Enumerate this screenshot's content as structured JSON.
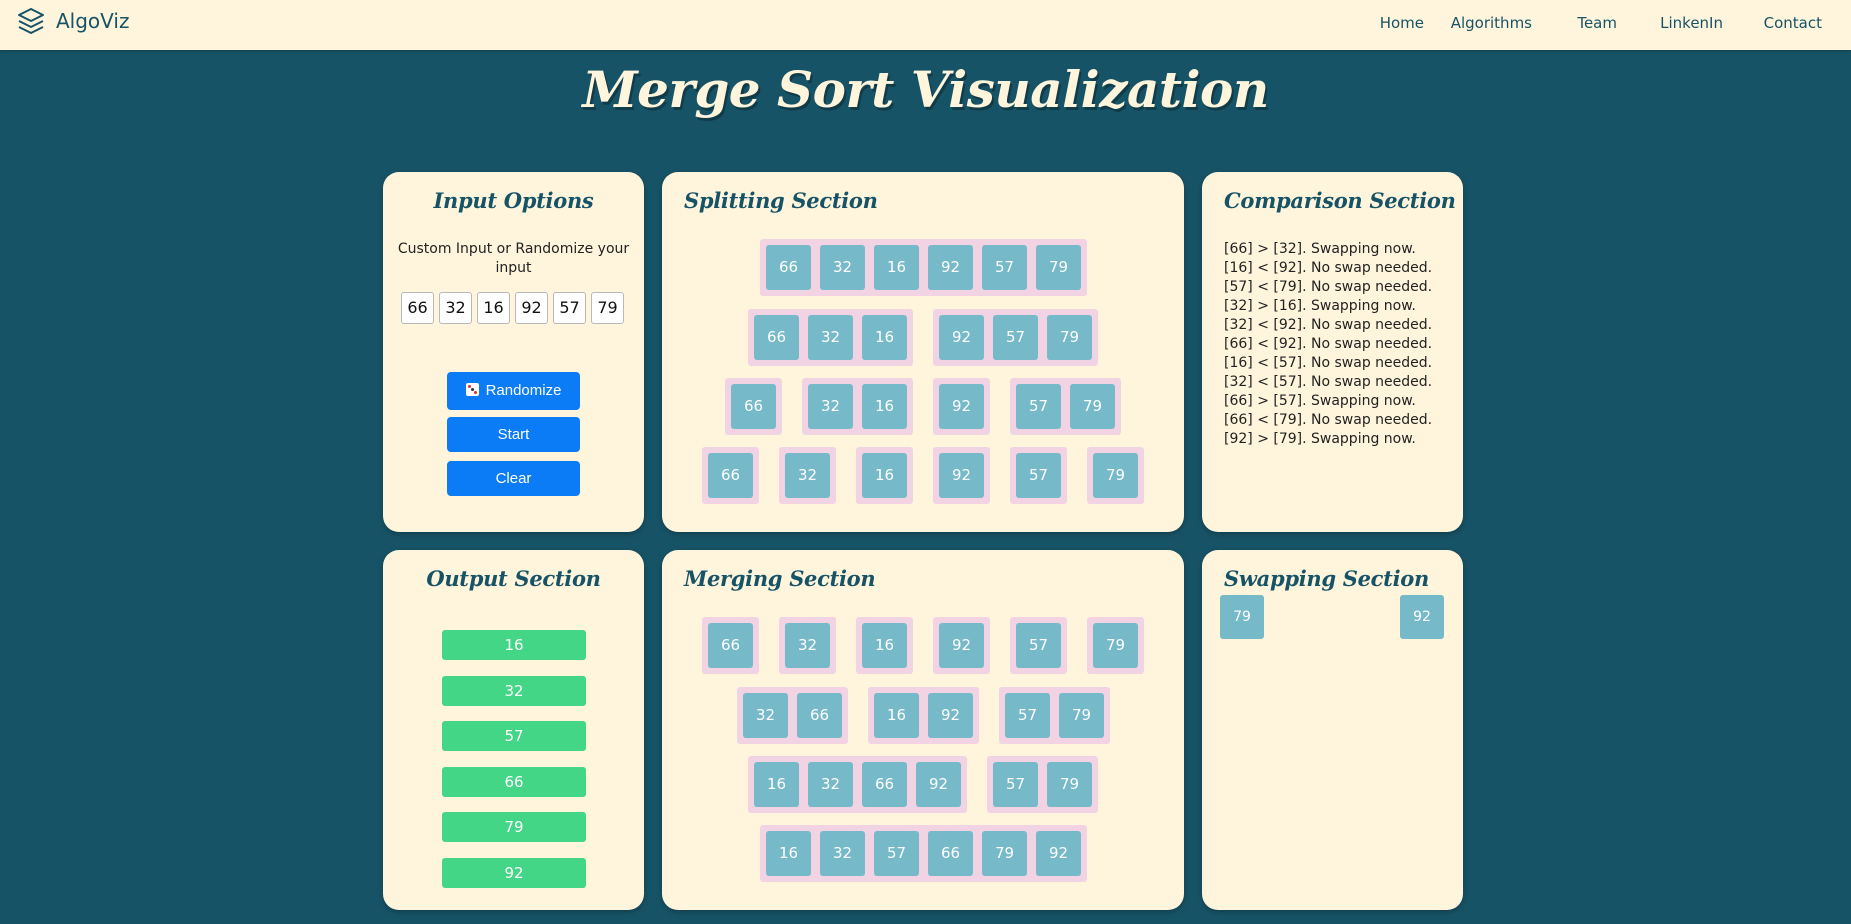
{
  "nav": {
    "brand": "AlgoViz",
    "brand_icon": "layers-icon",
    "links": [
      "Home",
      "Algorithms",
      "Team",
      "LinkenIn",
      "Contact"
    ]
  },
  "title": "Merge Sort Visualization",
  "input": {
    "title": "Input Options",
    "description": "Custom Input or Randomize your input",
    "values": [
      "66",
      "32",
      "16",
      "92",
      "57",
      "79"
    ],
    "randomize_label": "Randomize",
    "randomize_icon": "dice-icon",
    "start_label": "Start",
    "clear_label": "Clear",
    "button_color": "#0b7bf6"
  },
  "splitting": {
    "title": "Splitting Section",
    "rows": [
      [
        [
          "66",
          "32",
          "16",
          "92",
          "57",
          "79"
        ]
      ],
      [
        [
          "66",
          "32",
          "16"
        ],
        [
          "92",
          "57",
          "79"
        ]
      ],
      [
        [
          "66"
        ],
        [
          "32",
          "16"
        ],
        [
          "92"
        ],
        [
          "57",
          "79"
        ]
      ],
      [
        [
          "66"
        ],
        [
          "32"
        ],
        [
          "16"
        ],
        [
          "92"
        ],
        [
          "57"
        ],
        [
          "79"
        ]
      ]
    ]
  },
  "comparison": {
    "title": "Comparison Section",
    "lines": [
      "[66] > [32]. Swapping now.",
      "[16] < [92]. No swap needed.",
      "[57] < [79]. No swap needed.",
      "[32] > [16]. Swapping now.",
      "[32] < [92]. No swap needed.",
      "[66] < [92]. No swap needed.",
      "[16] < [57]. No swap needed.",
      "[32] < [57]. No swap needed.",
      "[66] > [57]. Swapping now.",
      "[66] < [79]. No swap needed.",
      "[92] > [79]. Swapping now."
    ]
  },
  "output": {
    "title": "Output Section",
    "values": [
      "16",
      "32",
      "57",
      "66",
      "79",
      "92"
    ],
    "bar_color": "#42d686"
  },
  "merging": {
    "title": "Merging Section",
    "rows": [
      [
        [
          "66"
        ],
        [
          "32"
        ],
        [
          "16"
        ],
        [
          "92"
        ],
        [
          "57"
        ],
        [
          "79"
        ]
      ],
      [
        [
          "32",
          "66"
        ],
        [
          "16",
          "92"
        ],
        [
          "57",
          "79"
        ]
      ],
      [
        [
          "16",
          "32",
          "66",
          "92"
        ],
        [
          "57",
          "79"
        ]
      ],
      [
        [
          "16",
          "32",
          "57",
          "66",
          "79",
          "92"
        ]
      ]
    ]
  },
  "swapping": {
    "title": "Swapping Section",
    "left_value": "79",
    "right_value": "92"
  },
  "colors": {
    "background": "#175366",
    "panel": "#fff5dc",
    "cell": "#76b9c8",
    "group": "#f2d3e4"
  }
}
